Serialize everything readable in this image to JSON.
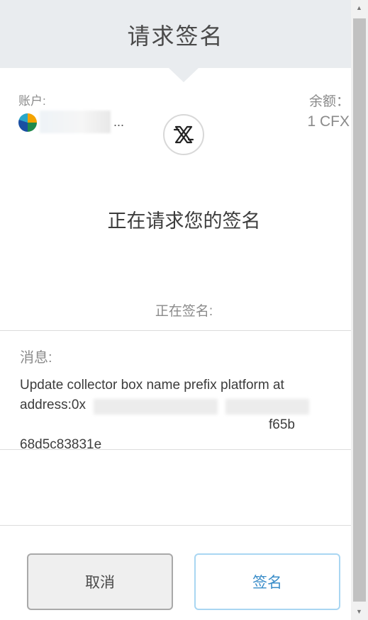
{
  "header": {
    "title": "请求签名"
  },
  "account": {
    "label": "账户:",
    "name_suffix": "..."
  },
  "balance": {
    "label": "余额：",
    "value": "1 CFX"
  },
  "request": {
    "title": "正在请求您的签名",
    "signing_label": "正在签名:"
  },
  "message": {
    "label": "消息:",
    "line1": "Update collector box name prefix platform at",
    "line2": "address:0x",
    "line2_end": "f65b",
    "line3": "68d5c83831e"
  },
  "buttons": {
    "cancel": "取消",
    "sign": "签名"
  },
  "colors": {
    "header_bg": "#e9ecef",
    "sign_accent": "#3a8dc9",
    "sign_border": "#a9d6f2"
  }
}
